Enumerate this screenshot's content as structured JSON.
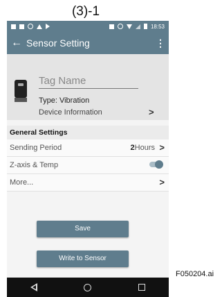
{
  "figure_label": "(3)-1",
  "figure_code": "F050204.ai",
  "status_bar": {
    "time": "18:53"
  },
  "app_bar": {
    "back_icon": "←",
    "title": "Sensor Setting",
    "menu_icon": "⋮"
  },
  "device": {
    "tag_name_placeholder": "Tag Name",
    "type_label": "Type:",
    "type_value": "Vibration",
    "device_information": "Device Information",
    "chevron": ">"
  },
  "general_settings": {
    "header": "General Settings",
    "sending_period": {
      "label": "Sending Period",
      "value_number": "2",
      "value_unit": "Hours",
      "chevron": ">"
    },
    "z_axis_temp": {
      "label": "Z-axis & Temp",
      "enabled": true
    },
    "more": {
      "label": "More...",
      "chevron": ">"
    }
  },
  "buttons": {
    "save": "Save",
    "write_to_sensor": "Write to Sensor"
  },
  "colors": {
    "primary": "#5f7d8d",
    "nav_bar": "#111111"
  }
}
